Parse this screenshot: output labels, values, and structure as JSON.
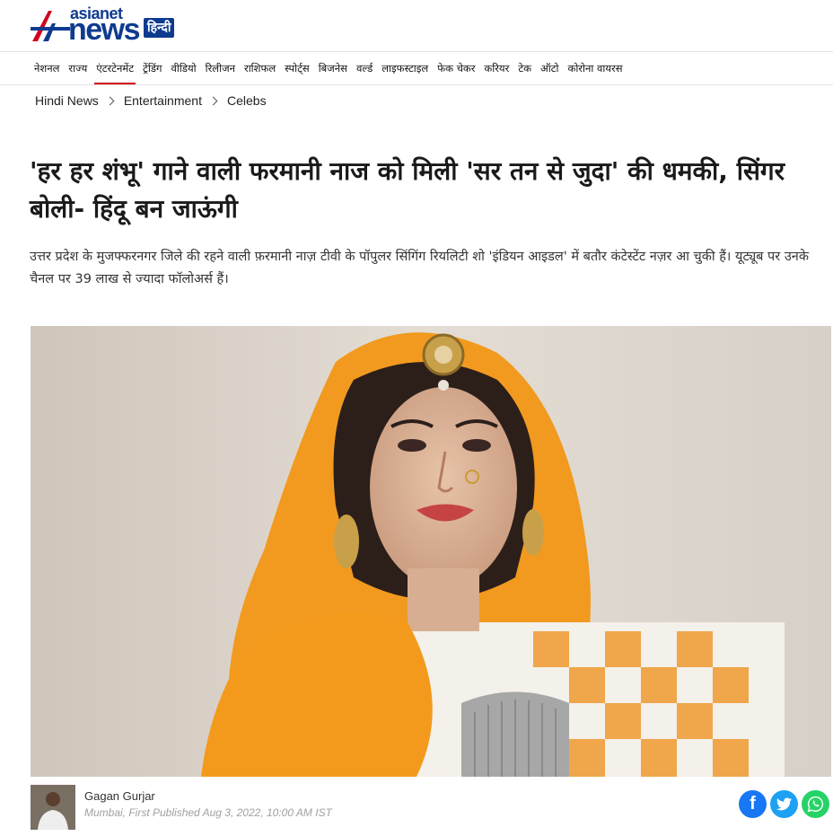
{
  "brand": {
    "name": "asianet",
    "news": "news",
    "hindi": "हिन्दी",
    "primary_color": "#0e3b8f",
    "accent_color": "#d0021b"
  },
  "nav": {
    "items": [
      {
        "label": "नेशनल",
        "active": false
      },
      {
        "label": "राज्य",
        "active": false
      },
      {
        "label": "एंटरटेनमेंट",
        "active": true
      },
      {
        "label": "ट्रेंडिंग",
        "active": false
      },
      {
        "label": "वीडियो",
        "active": false
      },
      {
        "label": "रिलीजन",
        "active": false
      },
      {
        "label": "राशिफल",
        "active": false
      },
      {
        "label": "स्पोर्ट्स",
        "active": false
      },
      {
        "label": "बिजनेस",
        "active": false
      },
      {
        "label": "वर्ल्ड",
        "active": false
      },
      {
        "label": "लाइफस्टाइल",
        "active": false
      },
      {
        "label": "फेक चेकर",
        "active": false
      },
      {
        "label": "करियर",
        "active": false
      },
      {
        "label": "टेक",
        "active": false
      },
      {
        "label": "ऑटो",
        "active": false
      },
      {
        "label": "कोरोना वायरस",
        "active": false
      }
    ]
  },
  "breadcrumb": {
    "items": [
      "Hindi News",
      "Entertainment",
      "Celebs"
    ]
  },
  "article": {
    "title": "'हर हर शंभू' गाने वाली फरमानी नाज को मिली 'सर तन से जुदा' की धमकी, सिंगर बोली- हिंदू बन जाऊंगी",
    "summary": "उत्तर प्रदेश के मुजफ्फरनगर जिले की रहने वाली फ़रमानी नाज़ टीवी के पॉपुलर सिंगिंग रियलिटी शो 'इंडियन आइडल' में बतौर कंटेस्टेंट नज़र आ चुकी हैं। यूट्यूब पर उनके चैनल पर 39 लाख से ज्यादा फॉलोअर्स हैं।"
  },
  "author": {
    "name": "Gagan Gurjar",
    "meta": "Mumbai, First Published Aug 3, 2022, 10:00 AM IST"
  },
  "share": {
    "facebook_icon": "facebook-icon",
    "twitter_icon": "twitter-icon",
    "whatsapp_icon": "whatsapp-icon",
    "facebook_color": "#1877f2",
    "twitter_color": "#1da1f2",
    "whatsapp_color": "#25d366"
  }
}
